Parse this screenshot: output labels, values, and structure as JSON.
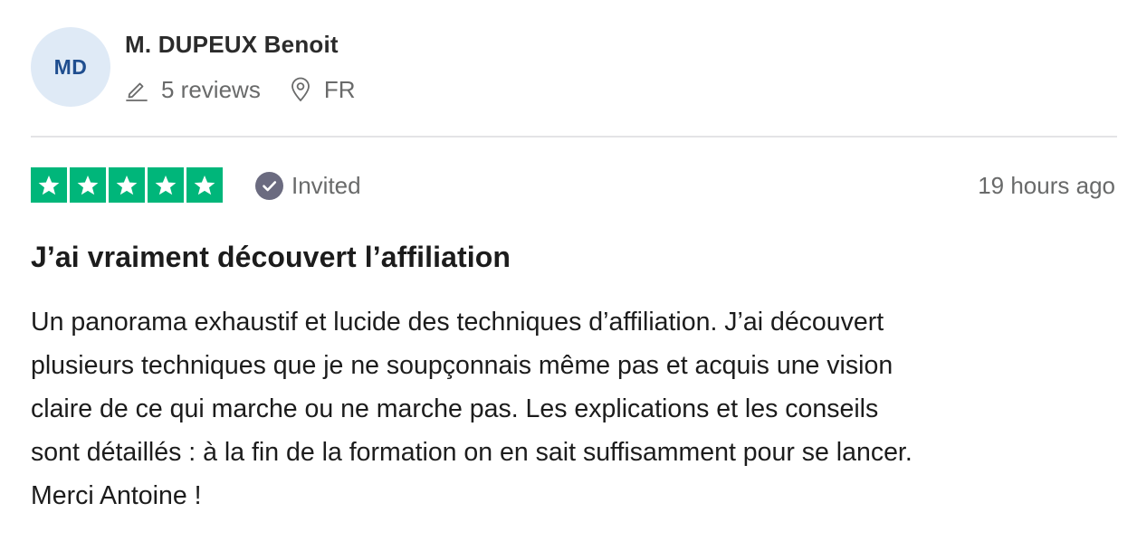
{
  "reviewer": {
    "initials": "MD",
    "name": "M. DUPEUX Benoit",
    "reviews_label": "5 reviews",
    "country": "FR"
  },
  "rating": {
    "stars": 5,
    "color": "#00b67a"
  },
  "badge": {
    "label": "Invited"
  },
  "date": "19 hours ago",
  "review": {
    "title": "J’ai vraiment découvert l’affiliation",
    "lines": [
      "Un panorama exhaustif et lucide des techniques d’affiliation. J’ai découvert",
      "plusieurs techniques que je ne soupçonnais même pas et acquis une vision",
      "claire de ce qui marche ou ne marche pas. Les explications et les conseils",
      "sont détaillés : à la fin de la formation on en sait suffisamment pour se lancer.",
      "Merci Antoine !"
    ]
  },
  "icons": {
    "reviews": "pencil-icon",
    "location": "location-pin-icon",
    "invited": "check-circle-icon",
    "star": "star-icon"
  }
}
